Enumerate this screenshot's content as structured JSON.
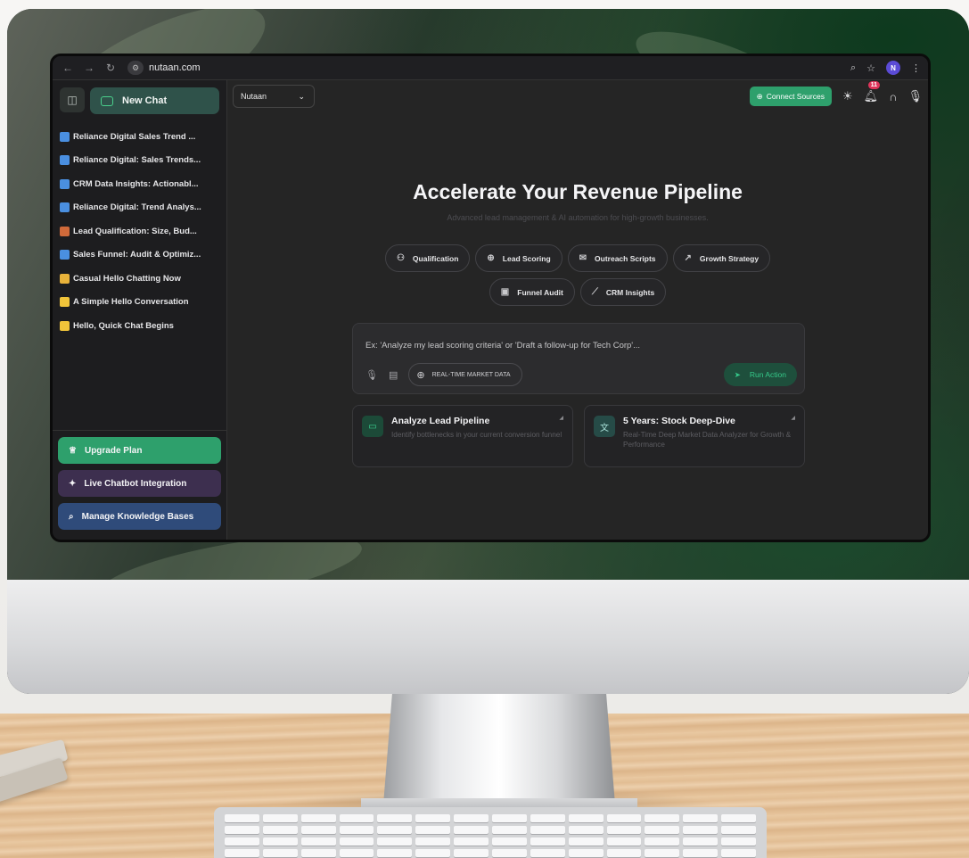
{
  "browser": {
    "url": "nutaan.com",
    "profile_initial": "N"
  },
  "sidebar": {
    "new_chat_label": "New Chat",
    "history": [
      {
        "label": "Reliance Digital Sales Trend ...",
        "icon_color": "#4a8fe0"
      },
      {
        "label": "Reliance Digital: Sales Trends...",
        "icon_color": "#4a8fe0"
      },
      {
        "label": "CRM Data Insights: Actionabl...",
        "icon_color": "#4a8fe0"
      },
      {
        "label": "Reliance Digital: Trend Analys...",
        "icon_color": "#4a8fe0"
      },
      {
        "label": "Lead Qualification: Size, Bud...",
        "icon_color": "#d06a3a"
      },
      {
        "label": "Sales Funnel: Audit & Optimiz...",
        "icon_color": "#4a8fe0"
      },
      {
        "label": "Casual Hello Chatting Now",
        "icon_color": "#e8b23a"
      },
      {
        "label": "A Simple Hello Conversation",
        "icon_color": "#f0c43a"
      },
      {
        "label": "Hello, Quick Chat Begins",
        "icon_color": "#f0c43a"
      }
    ],
    "upgrade_label": "Upgrade Plan",
    "chatbot_label": "Live Chatbot Integration",
    "kb_label": "Manage Knowledge Bases"
  },
  "topbar": {
    "workspace": "Nutaan",
    "connect_label": "Connect Sources",
    "notification_count": "11"
  },
  "hero": {
    "title": "Accelerate Your Revenue Pipeline",
    "subtitle": "Advanced lead management & AI automation for high-growth businesses."
  },
  "chips": {
    "row1": [
      "Qualification",
      "Lead Scoring",
      "Outreach Scripts",
      "Growth Strategy"
    ],
    "row2": [
      "Funnel Audit",
      "CRM Insights"
    ]
  },
  "prompt": {
    "placeholder": "Ex: 'Analyze my lead scoring criteria' or 'Draft a follow-up for Tech Corp'...",
    "market_label": "REAL-TIME MARKET DATA",
    "run_label": "Run Action"
  },
  "cards": [
    {
      "title": "Analyze Lead Pipeline",
      "desc": "Identify bottlenecks in your current conversion funnel"
    },
    {
      "title": "5 Years: Stock Deep-Dive",
      "desc": "Real-Time Deep Market Data Analyzer for Growth & Performance"
    }
  ],
  "colors": {
    "accent_green": "#2ea06c",
    "chatbot_purple": "#3d2f4f",
    "kb_blue": "#2f4b7a",
    "badge_red": "#e0345a"
  }
}
